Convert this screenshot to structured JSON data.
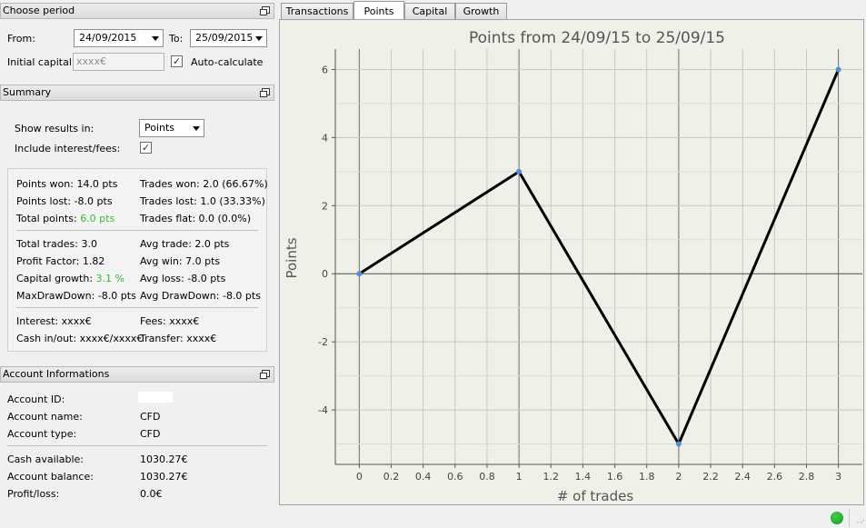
{
  "period": {
    "title": "Choose period",
    "from_label": "From:",
    "from_value": "24/09/2015",
    "to_label": "To:",
    "to_value": "25/09/2015",
    "capital_label": "Initial capital:",
    "capital_value": "xxxx€",
    "auto_label": "Auto-calculate",
    "auto_checked": "✓"
  },
  "summary": {
    "title": "Summary",
    "show_label": "Show results in:",
    "show_value": "Points",
    "interest_label": "Include interest/fees:",
    "interest_checked": "✓",
    "col1": [
      [
        "Points won: 14.0 pts",
        "Points lost: -8.0 pts",
        "Total points: ",
        "6.0 pts"
      ],
      [
        "Total trades: 3.0",
        "Profit Factor: 1.82",
        "Capital growth: ",
        "3.1 %",
        "MaxDrawDown: -8.0 pts"
      ],
      [
        "Interest: xxxx€",
        "Cash in/out: xxxx€/xxxx€"
      ]
    ],
    "points_won": "Points won: 14.0 pts",
    "points_lost": "Points lost: -8.0 pts",
    "total_points_label": "Total points: ",
    "total_points_value": "6.0 pts",
    "trades_won": "Trades won: 2.0 (66.67%)",
    "trades_lost": "Trades lost: 1.0 (33.33%)",
    "trades_flat": "Trades flat: 0.0 (0.0%)",
    "total_trades": "Total trades: 3.0",
    "profit_factor": "Profit Factor: 1.82",
    "capital_growth_label": "Capital growth: ",
    "capital_growth_value": "3.1 %",
    "maxdd": "MaxDrawDown: -8.0 pts",
    "avg_trade": "Avg trade: 2.0 pts",
    "avg_win": "Avg win: 7.0 pts",
    "avg_loss": "Avg loss: -8.0 pts",
    "avg_dd": "Avg DrawDown: -8.0 pts",
    "interest": "Interest: xxxx€",
    "cash": "Cash in/out: xxxx€/xxxx€",
    "fees": "Fees: xxxx€",
    "transfer": "Transfer: xxxx€"
  },
  "account": {
    "title": "Account Informations",
    "id_label": "Account ID:",
    "name_label": "Account name:",
    "name_value": "CFD",
    "type_label": "Account type:",
    "type_value": "CFD",
    "cash_label": "Cash available:",
    "cash_value": "1030.27€",
    "balance_label": "Account balance:",
    "balance_value": "1030.27€",
    "pl_label": "Profit/loss:",
    "pl_value": "0.0€"
  },
  "tabs": [
    "Transactions",
    "Points",
    "Capital",
    "Growth"
  ],
  "colors": {
    "accent_green": "#37b837",
    "line": "#000000",
    "point": "#4f8fd6",
    "plot_bg": "#f0f0e8"
  },
  "chart_data": {
    "type": "line",
    "title": "Points from 24/09/15 to 25/09/15",
    "xlabel": "# of trades",
    "ylabel": "Points",
    "x": [
      0,
      1,
      2,
      3
    ],
    "series": [
      {
        "values": [
          0,
          3,
          -5,
          6
        ]
      }
    ],
    "xlim": [
      -0.15,
      3.15
    ],
    "ylim": [
      -5.6,
      6.6
    ],
    "xticks": [
      0,
      0.2,
      0.4,
      0.6,
      0.8,
      1,
      1.2,
      1.4,
      1.6,
      1.8,
      2,
      2.2,
      2.4,
      2.6,
      2.8,
      3
    ],
    "xtick_labels": [
      "0",
      "0.2",
      "0.4",
      "0.6",
      "0.8",
      "1",
      "1.2",
      "1.4",
      "1.6",
      "1.8",
      "2",
      "2.2",
      "2.4",
      "2.6",
      "2.8",
      "3"
    ],
    "yticks": [
      -4,
      -2,
      0,
      2,
      4,
      6
    ],
    "ytick_labels": [
      "-4",
      "-2",
      "0",
      "2",
      "4",
      "6"
    ],
    "grid": true
  }
}
